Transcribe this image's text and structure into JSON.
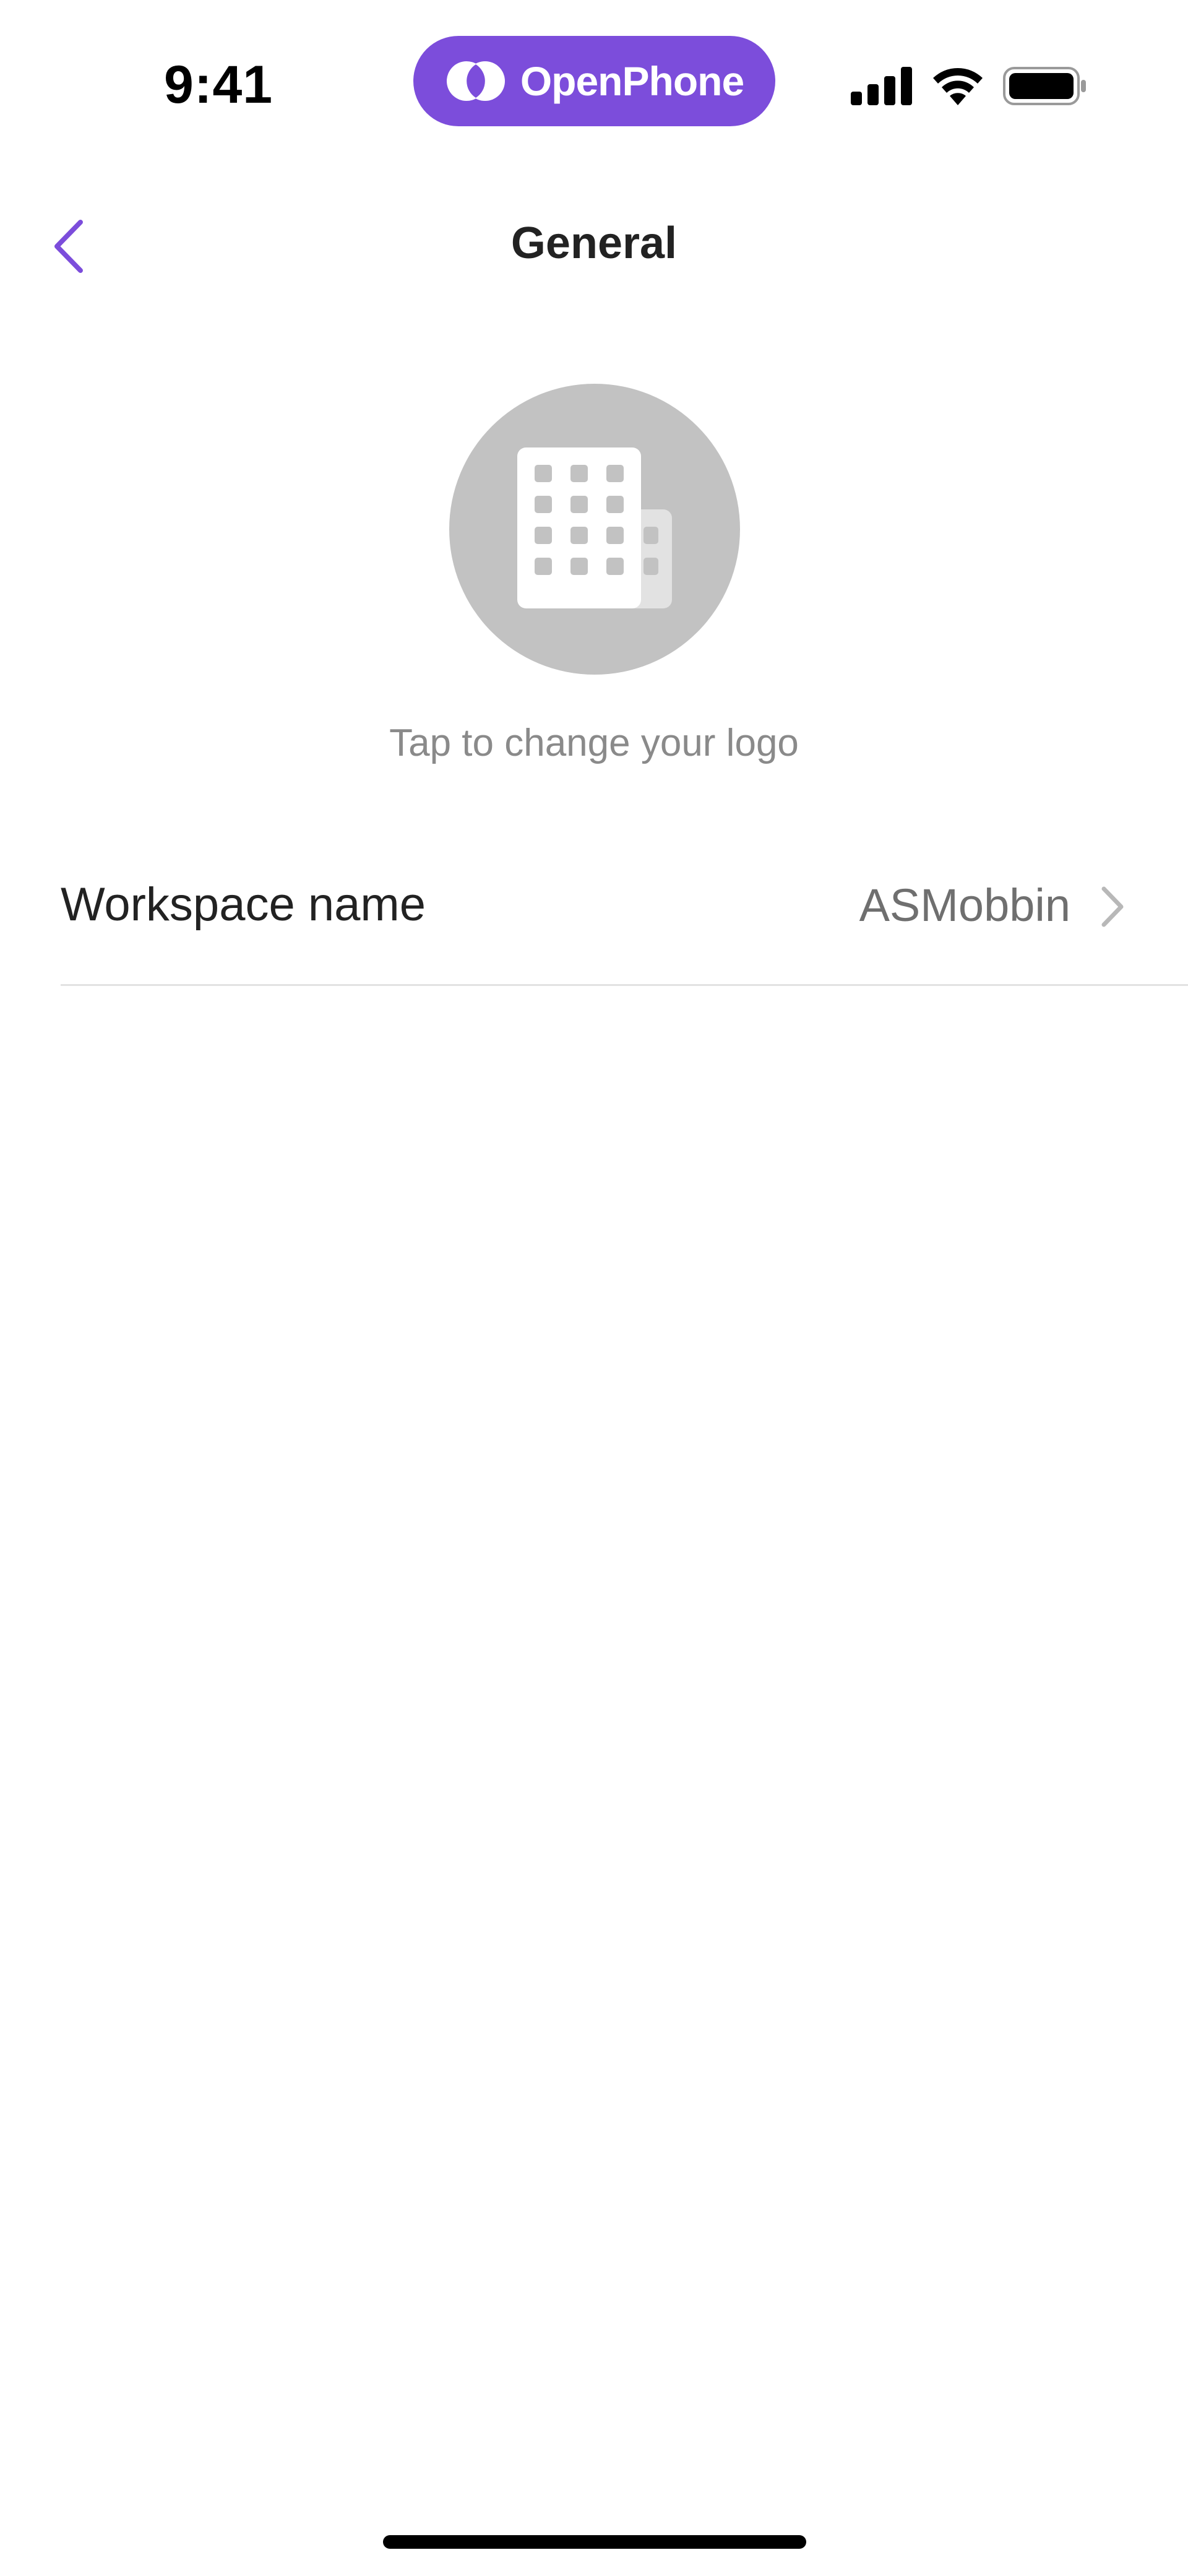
{
  "status_bar": {
    "time": "9:41",
    "brand_name": "OpenPhone",
    "icons": [
      "cellular-signal-icon",
      "wifi-icon",
      "battery-icon"
    ]
  },
  "nav": {
    "title": "General",
    "back_icon": "chevron-left-icon"
  },
  "logo": {
    "icon": "building-icon",
    "caption": "Tap to change your logo"
  },
  "settings": {
    "rows": [
      {
        "label": "Workspace name",
        "value": "ASMobbin",
        "icon": "chevron-right-icon"
      }
    ]
  },
  "colors": {
    "accent": "#7c4ddb",
    "avatar_bg": "#c2c2c2",
    "text_primary": "#222222",
    "text_secondary": "#8a8a8a",
    "divider": "#e2e2e2"
  }
}
